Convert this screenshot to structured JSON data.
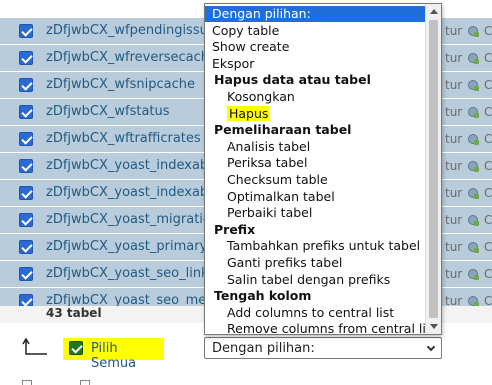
{
  "table": {
    "rows": [
      {
        "name": "zDfjwbCX_wfpendingissu",
        "suffix": "tur",
        "extra": "C"
      },
      {
        "name": "zDfjwbCX_wfreversecach",
        "suffix": "tur",
        "extra": "C"
      },
      {
        "name": "zDfjwbCX_wfsnipcache",
        "suffix": "tur",
        "extra": "C"
      },
      {
        "name": "zDfjwbCX_wfstatus",
        "suffix": "tur",
        "extra": "C"
      },
      {
        "name": "zDfjwbCX_wftrafficrates",
        "suffix": "tur",
        "extra": "C"
      },
      {
        "name": "zDfjwbCX_yoast_indexab",
        "suffix": "tur",
        "extra": "C"
      },
      {
        "name": "zDfjwbCX_yoast_indexab",
        "suffix": "tur",
        "extra": "C"
      },
      {
        "name": "zDfjwbCX_yoast_migratio",
        "suffix": "tur",
        "extra": "C"
      },
      {
        "name": "zDfjwbCX_yoast_primary",
        "suffix": "tur",
        "extra": "C"
      },
      {
        "name": "zDfjwbCX_yoast_seo_link",
        "suffix": "tur",
        "extra": "C"
      },
      {
        "name": "zDfjwbCX_yoast_seo_me",
        "suffix": "tur",
        "extra": "C"
      }
    ],
    "count_label": "43 tabel"
  },
  "footer": {
    "select_all_label": "Pilih Semua",
    "select_value": "Dengan pilihan:"
  },
  "dropdown": {
    "options": [
      {
        "label": "Dengan pilihan:",
        "kind": "highlighted"
      },
      {
        "label": "Copy table",
        "kind": "item"
      },
      {
        "label": "Show create",
        "kind": "item"
      },
      {
        "label": "Ekspor",
        "kind": "item"
      },
      {
        "label": "Hapus data atau tabel",
        "kind": "group"
      },
      {
        "label": "Kosongkan",
        "kind": "child"
      },
      {
        "label": "Hapus",
        "kind": "child-marked"
      },
      {
        "label": "Pemeliharaan tabel",
        "kind": "group"
      },
      {
        "label": "Analisis tabel",
        "kind": "child"
      },
      {
        "label": "Periksa tabel",
        "kind": "child"
      },
      {
        "label": "Checksum table",
        "kind": "child"
      },
      {
        "label": "Optimalkan tabel",
        "kind": "child"
      },
      {
        "label": "Perbaiki tabel",
        "kind": "child"
      },
      {
        "label": "Prefix",
        "kind": "group"
      },
      {
        "label": "Tambahkan prefiks untuk tabel",
        "kind": "child"
      },
      {
        "label": "Ganti prefiks tabel",
        "kind": "child"
      },
      {
        "label": "Salin tabel dengan prefiks",
        "kind": "child"
      },
      {
        "label": "Tengah kolom",
        "kind": "group"
      },
      {
        "label": "Add columns to central list",
        "kind": "child"
      },
      {
        "label": "Remove columns from central list",
        "kind": "child"
      }
    ]
  },
  "icons": {
    "row_checkbox": "checked-checkbox-icon",
    "row_action": "table-structure-icon",
    "back_arrow": "arrow-up-left-icon",
    "select_chevron": "chevron-down-icon"
  },
  "colors": {
    "selected_row": "#b9ccdc",
    "highlight_option": "#1e6fdc",
    "marker_yellow": "#ffff00"
  }
}
